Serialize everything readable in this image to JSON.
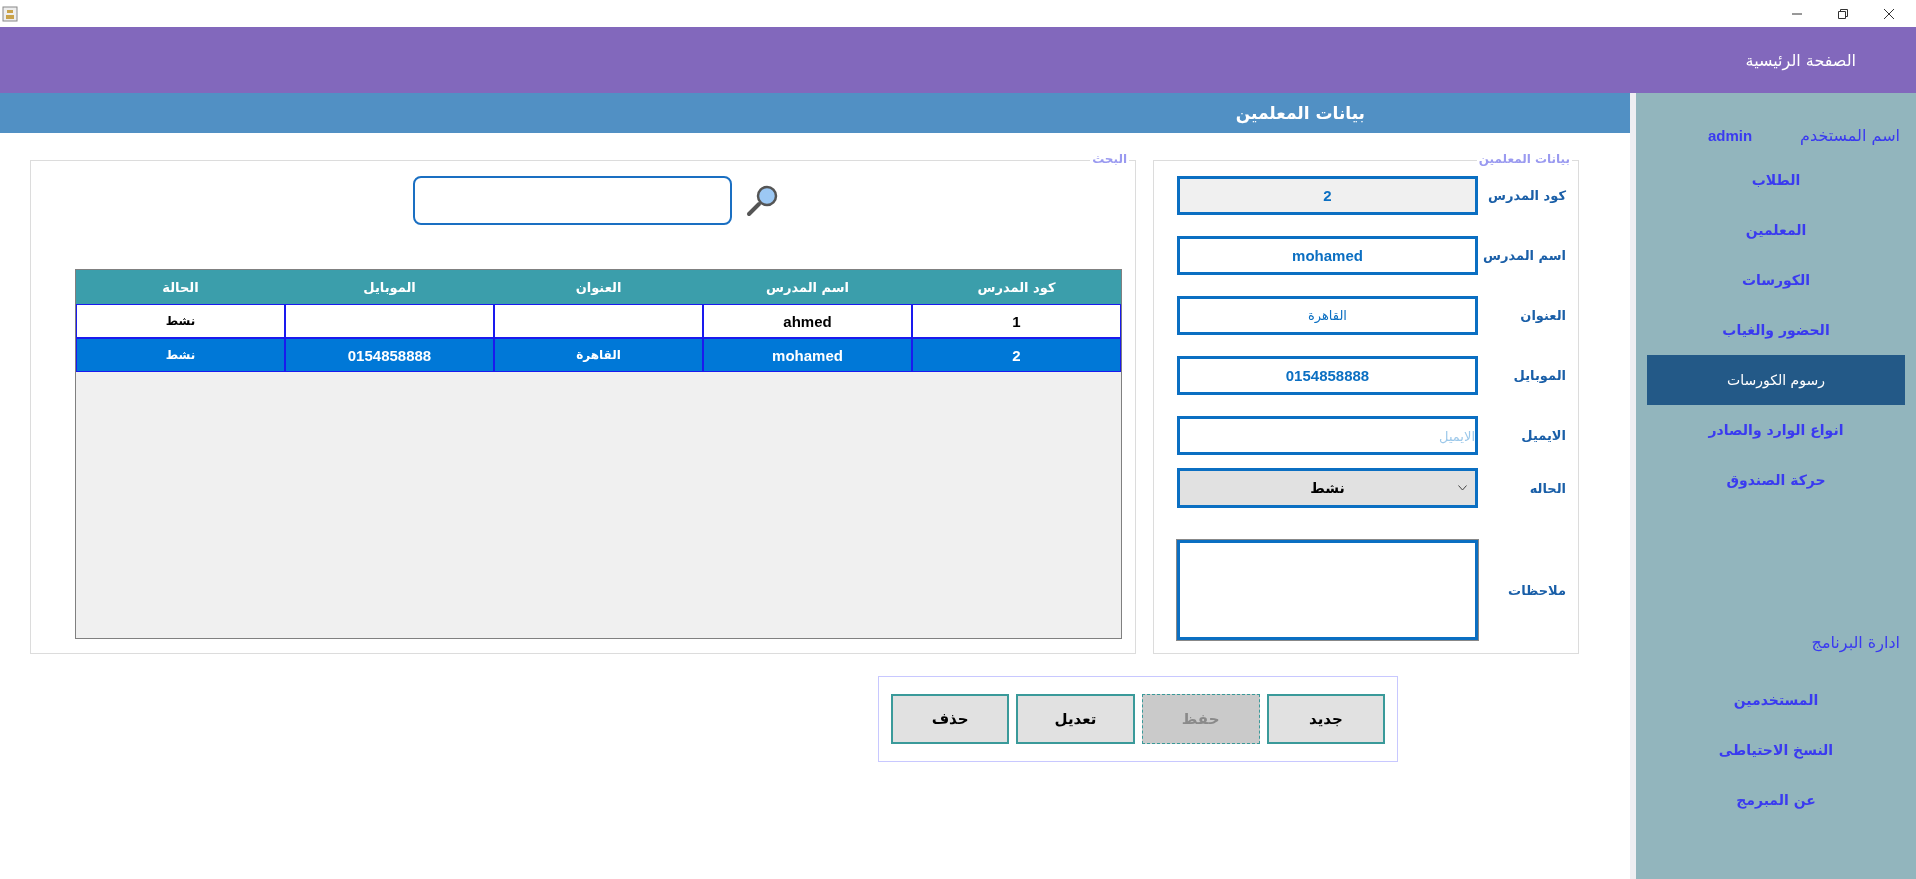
{
  "header": {
    "title": "الصفحة الرئيسية"
  },
  "section_title": "بيانات المعلمين",
  "search": {
    "legend": "البحث"
  },
  "table": {
    "columns": [
      "كود المدرس",
      "اسم المدرس",
      "العنوان",
      "الموبايل",
      "الحالة"
    ],
    "rows": [
      {
        "cells": [
          "1",
          "ahmed",
          null,
          null,
          "نشط"
        ],
        "selected": false
      },
      {
        "cells": [
          "2",
          "mohamed",
          "القاهرة",
          "0154858888",
          "نشط"
        ],
        "selected": true
      }
    ]
  },
  "form": {
    "legend": "بيانات المعلمين",
    "fields": [
      {
        "kind": "text",
        "label": "كود المدرس",
        "value": "2",
        "disabled": true
      },
      {
        "kind": "text",
        "label": "اسم المدرس",
        "value": "mohamed",
        "disabled": false
      },
      {
        "kind": "text",
        "label": "العنوان",
        "value": "القاهرة",
        "disabled": false
      },
      {
        "kind": "text",
        "label": "الموبايل",
        "value": "0154858888",
        "disabled": false
      },
      {
        "kind": "text",
        "label": "الايميل",
        "placeholder": "الايميل",
        "disabled": false
      },
      {
        "kind": "select",
        "label": "الحاله",
        "value": "نشط",
        "disabled": false
      },
      {
        "kind": "textarea",
        "label": "ملاحظات"
      }
    ]
  },
  "buttons": [
    {
      "label": "جديد",
      "disabled": false
    },
    {
      "label": "حفظ",
      "disabled": true
    },
    {
      "label": "تعديل",
      "disabled": false
    },
    {
      "label": "حذف",
      "disabled": false
    }
  ],
  "sidebar": {
    "user_label": "اسم المستخدم",
    "user_name": "admin",
    "items": [
      {
        "label": "الطلاب",
        "selected": false
      },
      {
        "label": "المعلمين",
        "selected": false
      },
      {
        "label": "الكورسات",
        "selected": false
      },
      {
        "label": "الحضور والغياب",
        "selected": false
      },
      {
        "label": "رسوم الكورسات",
        "selected": true
      },
      {
        "label": "انواع الوارد والصادر",
        "selected": false
      },
      {
        "label": "حركة الصندوق",
        "selected": false
      }
    ],
    "admin_heading": "ادارة البرنامج",
    "admin_items": [
      {
        "label": "المستخدمين",
        "selected": false
      },
      {
        "label": "النسخ الاحتياطى",
        "selected": false
      },
      {
        "label": "عن المبرمج",
        "selected": false
      }
    ]
  }
}
